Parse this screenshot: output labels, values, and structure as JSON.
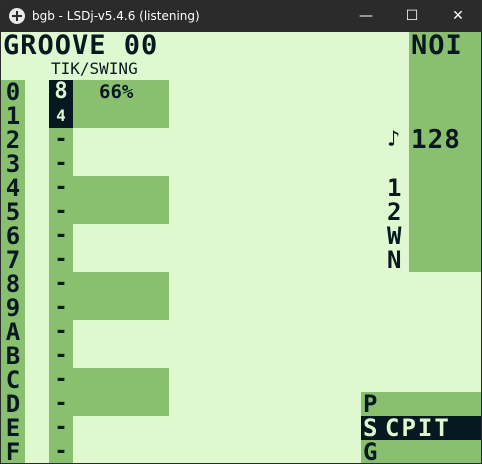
{
  "window": {
    "title": "bgb - LSDj-v5.4.6 (listening)"
  },
  "controls": {
    "minimize": "—",
    "maximize": "☐",
    "close": "✕"
  },
  "groove": {
    "title": "GROOVE 00",
    "header": "TIK/SWING",
    "swing": "66%",
    "rows": [
      "0",
      "1",
      "2",
      "3",
      "4",
      "5",
      "6",
      "7",
      "8",
      "9",
      "A",
      "B",
      "C",
      "D",
      "E",
      "F"
    ],
    "values": [
      "8",
      "4",
      "-",
      "-",
      "-",
      "-",
      "-",
      "-",
      "-",
      "-",
      "-",
      "-",
      "-",
      "-",
      "-",
      "-"
    ]
  },
  "sidebar": {
    "top": "NOI",
    "tempo_note": "♪",
    "tempo": "128",
    "channels": [
      "1",
      "2",
      "W",
      "N"
    ],
    "p": "P",
    "s": "S",
    "screens": "CPIT",
    "g": "G"
  },
  "colors": {
    "light": "#e0f8d0",
    "mid": "#88c070",
    "dark": "#081820"
  }
}
